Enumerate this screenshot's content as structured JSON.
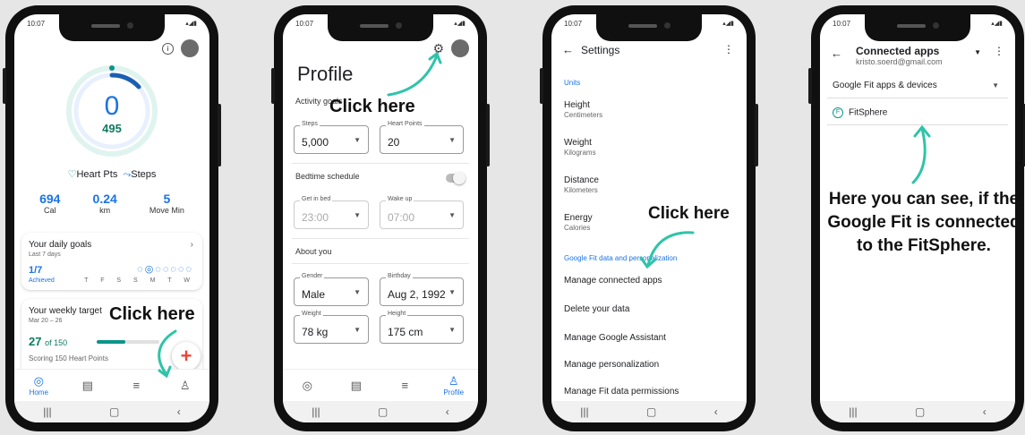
{
  "annotations": {
    "click1": "Click here",
    "click2": "Click here",
    "click3": "Click here",
    "result": "Here you can see, if the Google Fit is connected to the FitSphere."
  },
  "screen1": {
    "time": "10:07",
    "big_value": "0",
    "sub_value": "495",
    "legend_hp": "Heart Pts",
    "legend_steps": "Steps",
    "stats": [
      {
        "value": "694",
        "unit": "Cal"
      },
      {
        "value": "0.24",
        "unit": "km"
      },
      {
        "value": "5",
        "unit": "Move Min"
      }
    ],
    "daily_goals": {
      "title": "Your daily goals",
      "range": "Last 7 days",
      "count": "1/7",
      "status": "Achieved",
      "days": "T F S S M T W"
    },
    "weekly": {
      "title": "Your weekly target",
      "range": "Mar 20 – 26",
      "progress": "27",
      "of": "of 150",
      "scoring": "Scoring 150 Heart Points"
    },
    "tab_home": "Home"
  },
  "screen2": {
    "time": "10:07",
    "title": "Profile",
    "activity_goals": "Activity goals",
    "steps_label": "Steps",
    "steps_value": "5,000",
    "hp_label": "Heart Points",
    "hp_value": "20",
    "bedtime": "Bedtime schedule",
    "getin_label": "Get in bed",
    "getin_value": "23:00",
    "wake_label": "Wake up",
    "wake_value": "07:00",
    "about": "About you",
    "gender_label": "Gender",
    "gender_value": "Male",
    "birthday_label": "Birthday",
    "birthday_value": "Aug 2, 1992",
    "weight_label": "Weight",
    "weight_value": "78 kg",
    "height_label": "Height",
    "height_value": "175 cm",
    "tab_profile": "Profile"
  },
  "screen3": {
    "time": "10:07",
    "title": "Settings",
    "units": "Units",
    "items": [
      {
        "label": "Height",
        "sub": "Centimeters"
      },
      {
        "label": "Weight",
        "sub": "Kilograms"
      },
      {
        "label": "Distance",
        "sub": "Kilometers"
      },
      {
        "label": "Energy",
        "sub": "Calories"
      }
    ],
    "section2": "Google Fit data and personalization",
    "links": [
      "Manage connected apps",
      "Delete your data",
      "Manage Google Assistant",
      "Manage personalization",
      "Manage Fit data permissions"
    ]
  },
  "screen4": {
    "time": "10:07",
    "title": "Connected apps",
    "email": "kristo.soerd@gmail.com",
    "select": "Google Fit apps & devices",
    "app": "FitSphere"
  }
}
